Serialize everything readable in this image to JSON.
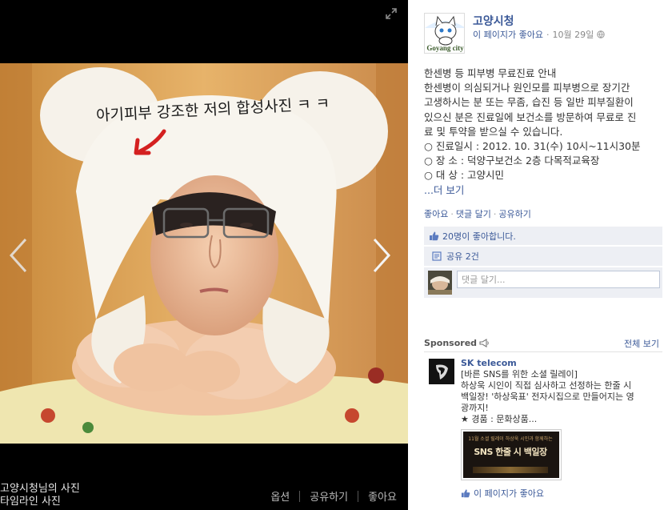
{
  "viewer": {
    "caption_line1": "고양시청님의 사진",
    "caption_line2": "타임라인 사진",
    "actions": {
      "options": "옵션",
      "share": "공유하기",
      "like": "좋아요"
    },
    "photo_overlay_text": "아기피부 강조한 저의 합성사진 ㅋ ㅋ"
  },
  "page": {
    "name": "고양시청",
    "like_link": "이 페이지가 좋아요",
    "date": "10월 29일",
    "logo_text": "Goyang city"
  },
  "post": {
    "lines": [
      "한센병 등 피부병 무료진료 안내",
      "한센병이 의심되거나 원인모를 피부병으로 장기간",
      "고생하시는 분 또는 무좀, 습진 등 일반 피부질환이",
      "있으신 분은 진료일에 보건소를 방문하여 무료로 진",
      "료 및 투약을 받으실 수 있습니다.",
      "○ 진료일시 : 2012. 10. 31(수) 10시~11시30분",
      "○ 장 소 : 덕양구보건소 2층 다목적교육장",
      "○ 대 상 : 고양시민"
    ],
    "more": "...더 보기",
    "actions": {
      "like": "좋아요",
      "comment": "댓글 달기",
      "share": "공유하기"
    },
    "likes_text": "20명이 좋아합니다.",
    "shares_text": "공유 2건",
    "comment_placeholder": "댓글 달기..."
  },
  "sponsored": {
    "label": "Sponsored",
    "see_all": "전체 보기",
    "ad": {
      "title": "SK telecom",
      "body": [
        "[바른 SNS를 위한 소셜 릴레이]",
        "하상욱 시인이 직접 심사하고 선정하는 한줄 시",
        "백일장! '하상욱표' 전자시집으로 만들어지는 영",
        "광까지!",
        "★ 경품 : 문화상품..."
      ],
      "image_small_text": "11월 소셜 릴레이 하상욱 시인과 함께하는",
      "image_big_text": "SNS 한줄 시 백일장",
      "like_link": "이 페이지가 좋아요"
    }
  },
  "colors": {
    "link": "#3b5998",
    "panel_box": "#edeff4",
    "viewer_bg": "#000000"
  }
}
